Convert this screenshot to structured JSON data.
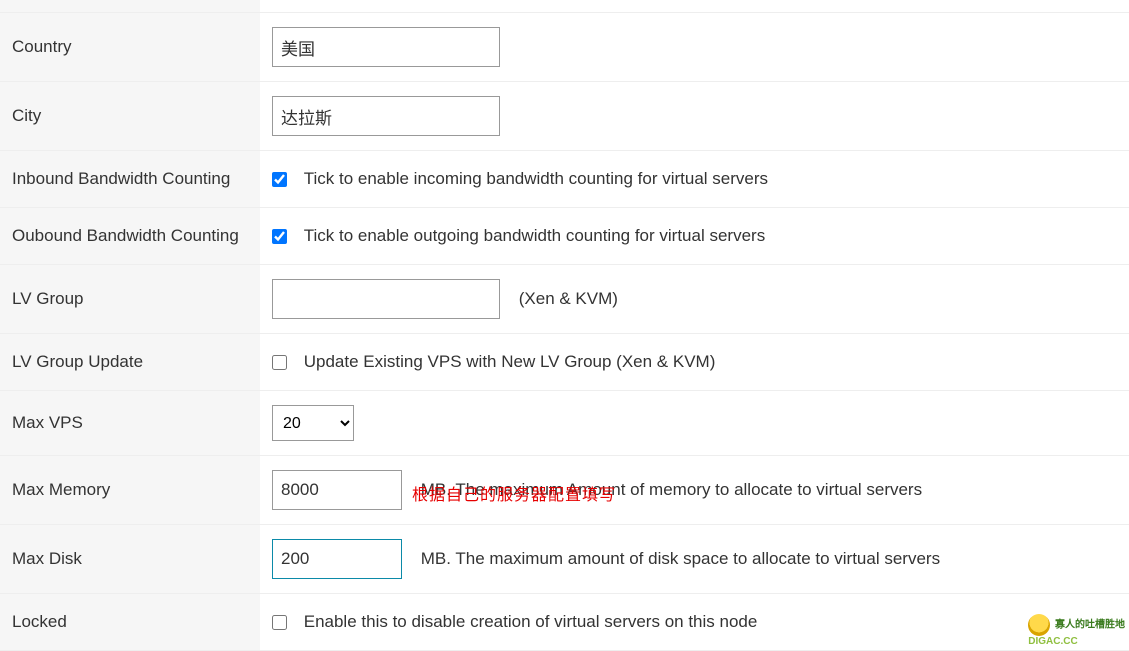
{
  "rows": {
    "country": {
      "label": "Country",
      "value": "美国"
    },
    "city": {
      "label": "City",
      "value": "达拉斯"
    },
    "inbound": {
      "label": "Inbound Bandwidth Counting",
      "checked": true,
      "desc": "Tick to enable incoming bandwidth counting for virtual servers"
    },
    "outbound": {
      "label": "Oubound Bandwidth Counting",
      "checked": true,
      "desc": "Tick to enable outgoing bandwidth counting for virtual servers"
    },
    "lvgroup": {
      "label": "LV Group",
      "value": "",
      "hint": "(Xen & KVM)"
    },
    "lvgroup_update": {
      "label": "LV Group Update",
      "checked": false,
      "desc": "Update Existing VPS with New LV Group  (Xen & KVM)"
    },
    "maxvps": {
      "label": "Max VPS",
      "value": "20"
    },
    "maxmem": {
      "label": "Max Memory",
      "value": "8000",
      "desc": "MB. The maximum Amount of memory to allocate to virtual servers"
    },
    "maxdisk": {
      "label": "Max Disk",
      "value": "200",
      "desc": "MB. The maximum amount of disk space to allocate to virtual servers"
    },
    "locked": {
      "label": "Locked",
      "checked": false,
      "desc": "Enable this to disable creation of virtual servers on this node"
    }
  },
  "red_note": "根据自己的服务器配置填写",
  "watermark": {
    "line1": "寡人的吐槽胜地",
    "line2": "DIGAC.CC"
  }
}
